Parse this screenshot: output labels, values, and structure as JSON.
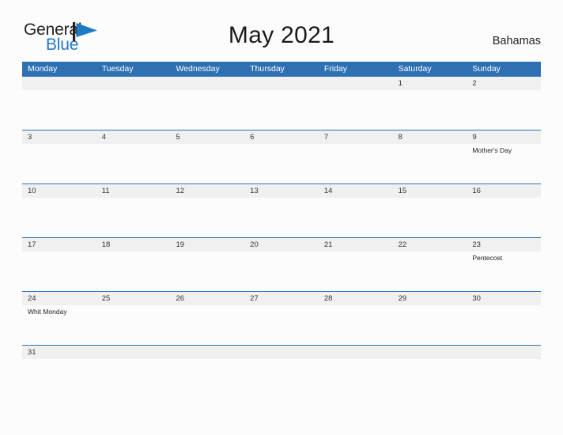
{
  "brand": {
    "name_part1": "General",
    "name_part2": "Blue",
    "accent_color": "#1f7ac4"
  },
  "header": {
    "title": "May 2021",
    "country": "Bahamas"
  },
  "theme": {
    "header_blue": "#2e71b3",
    "date_band_gray": "#f0f0f0",
    "page_background": "#fcfcfc"
  },
  "calendar": {
    "weekday_headers": [
      "Monday",
      "Tuesday",
      "Wednesday",
      "Thursday",
      "Friday",
      "Saturday",
      "Sunday"
    ],
    "weeks": [
      {
        "days": [
          {
            "date": "",
            "event": ""
          },
          {
            "date": "",
            "event": ""
          },
          {
            "date": "",
            "event": ""
          },
          {
            "date": "",
            "event": ""
          },
          {
            "date": "",
            "event": ""
          },
          {
            "date": "1",
            "event": ""
          },
          {
            "date": "2",
            "event": ""
          }
        ]
      },
      {
        "days": [
          {
            "date": "3",
            "event": ""
          },
          {
            "date": "4",
            "event": ""
          },
          {
            "date": "5",
            "event": ""
          },
          {
            "date": "6",
            "event": ""
          },
          {
            "date": "7",
            "event": ""
          },
          {
            "date": "8",
            "event": ""
          },
          {
            "date": "9",
            "event": "Mother's Day"
          }
        ]
      },
      {
        "days": [
          {
            "date": "10",
            "event": ""
          },
          {
            "date": "11",
            "event": ""
          },
          {
            "date": "12",
            "event": ""
          },
          {
            "date": "13",
            "event": ""
          },
          {
            "date": "14",
            "event": ""
          },
          {
            "date": "15",
            "event": ""
          },
          {
            "date": "16",
            "event": ""
          }
        ]
      },
      {
        "days": [
          {
            "date": "17",
            "event": ""
          },
          {
            "date": "18",
            "event": ""
          },
          {
            "date": "19",
            "event": ""
          },
          {
            "date": "20",
            "event": ""
          },
          {
            "date": "21",
            "event": ""
          },
          {
            "date": "22",
            "event": ""
          },
          {
            "date": "23",
            "event": "Pentecost"
          }
        ]
      },
      {
        "days": [
          {
            "date": "24",
            "event": "Whit Monday"
          },
          {
            "date": "25",
            "event": ""
          },
          {
            "date": "26",
            "event": ""
          },
          {
            "date": "27",
            "event": ""
          },
          {
            "date": "28",
            "event": ""
          },
          {
            "date": "29",
            "event": ""
          },
          {
            "date": "30",
            "event": ""
          }
        ]
      },
      {
        "compact": true,
        "days": [
          {
            "date": "31",
            "event": ""
          },
          {
            "date": "",
            "event": ""
          },
          {
            "date": "",
            "event": ""
          },
          {
            "date": "",
            "event": ""
          },
          {
            "date": "",
            "event": ""
          },
          {
            "date": "",
            "event": ""
          },
          {
            "date": "",
            "event": ""
          }
        ]
      }
    ]
  }
}
